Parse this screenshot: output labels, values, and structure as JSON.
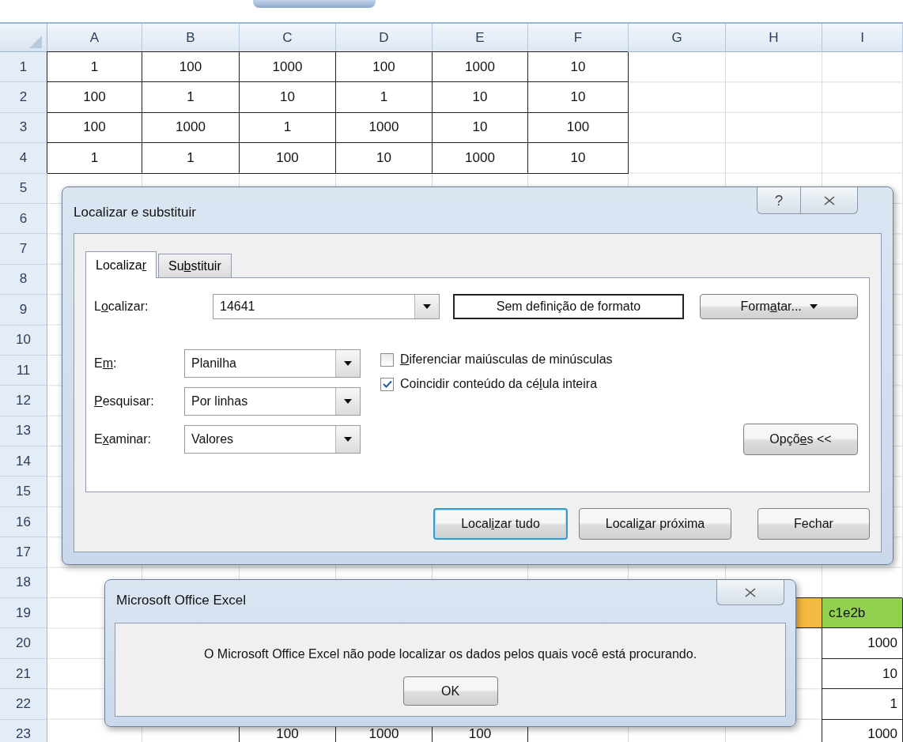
{
  "sheet": {
    "columns": [
      "A",
      "B",
      "C",
      "D",
      "E",
      "F",
      "G",
      "H",
      "I"
    ],
    "rows": [
      {
        "label": "1",
        "cells": [
          "1",
          "100",
          "1000",
          "100",
          "1000",
          "10",
          null,
          null,
          null
        ]
      },
      {
        "label": "2",
        "cells": [
          "100",
          "1",
          "10",
          "1",
          "10",
          "10",
          null,
          null,
          null
        ]
      },
      {
        "label": "3",
        "cells": [
          "100",
          "1000",
          "1",
          "1000",
          "10",
          "100",
          null,
          null,
          null
        ]
      },
      {
        "label": "4",
        "cells": [
          "1",
          "1",
          "100",
          "10",
          "1000",
          "10",
          null,
          null,
          null
        ]
      },
      {
        "label": "5",
        "cells": [
          null,
          null,
          null,
          null,
          null,
          null,
          null,
          null,
          null
        ]
      },
      {
        "label": "6",
        "cells": [
          null,
          null,
          null,
          null,
          null,
          null,
          null,
          null,
          null
        ]
      },
      {
        "label": "7",
        "cells": [
          null,
          null,
          null,
          null,
          null,
          null,
          null,
          null,
          null
        ]
      },
      {
        "label": "8",
        "cells": [
          null,
          null,
          null,
          null,
          null,
          null,
          null,
          null,
          null
        ]
      },
      {
        "label": "9",
        "cells": [
          null,
          null,
          null,
          null,
          null,
          null,
          null,
          null,
          null
        ]
      },
      {
        "label": "10",
        "cells": [
          null,
          null,
          null,
          null,
          null,
          null,
          null,
          null,
          null
        ]
      },
      {
        "label": "11",
        "cells": [
          null,
          null,
          null,
          null,
          null,
          null,
          null,
          null,
          null
        ]
      },
      {
        "label": "12",
        "cells": [
          null,
          null,
          null,
          null,
          null,
          null,
          null,
          null,
          null
        ]
      },
      {
        "label": "13",
        "cells": [
          null,
          null,
          null,
          null,
          null,
          null,
          null,
          null,
          null
        ]
      },
      {
        "label": "14",
        "cells": [
          null,
          null,
          null,
          null,
          null,
          null,
          null,
          null,
          null
        ]
      },
      {
        "label": "15",
        "cells": [
          null,
          null,
          null,
          null,
          null,
          null,
          null,
          null,
          null
        ]
      },
      {
        "label": "16",
        "cells": [
          null,
          null,
          null,
          null,
          null,
          null,
          null,
          null,
          null
        ]
      },
      {
        "label": "17",
        "cells": [
          null,
          null,
          null,
          null,
          null,
          null,
          null,
          null,
          null
        ]
      },
      {
        "label": "18",
        "cells": [
          null,
          null,
          null,
          null,
          null,
          null,
          null,
          null,
          null
        ]
      },
      {
        "label": "19",
        "cells": [
          null,
          null,
          null,
          null,
          null,
          null,
          null,
          {
            "color": "#f4b942"
          },
          {
            "text": "c1e2b",
            "color": "#92d050"
          }
        ]
      },
      {
        "label": "20",
        "cells": [
          null,
          null,
          null,
          null,
          null,
          null,
          null,
          null,
          "1000"
        ]
      },
      {
        "label": "21",
        "cells": [
          null,
          null,
          null,
          null,
          null,
          null,
          null,
          null,
          "10"
        ]
      },
      {
        "label": "22",
        "cells": [
          null,
          null,
          null,
          null,
          null,
          null,
          null,
          null,
          "1"
        ]
      },
      {
        "label": "23",
        "cells": [
          null,
          null,
          "100",
          "1000",
          "100",
          null,
          null,
          null,
          "1000"
        ]
      }
    ]
  },
  "find_dialog": {
    "title": "Localizar e substituir",
    "help_button": "?",
    "tabs": [
      {
        "pre": "Localiza",
        "key": "r",
        "selected": true
      },
      {
        "pre": "Su",
        "key": "b",
        "post": "stituir",
        "selected": false
      }
    ],
    "find_what": {
      "label": {
        "pre": "L",
        "key": "o",
        "post": "calizar:"
      },
      "value": "14641"
    },
    "format_preview": "Sem definição de formato",
    "format_button": {
      "pre": "Form",
      "key": "a",
      "post": "tar..."
    },
    "options": [
      {
        "label": {
          "pre": "E",
          "key": "m",
          "post": ":"
        },
        "value": "Planilha"
      },
      {
        "label": {
          "key": "P",
          "post": "esquisar:"
        },
        "value": "Por linhas"
      },
      {
        "label": {
          "pre": "E",
          "key": "x",
          "post": "aminar:"
        },
        "value": "Valores"
      }
    ],
    "checkboxes": [
      {
        "label": {
          "key": "D",
          "post": "iferenciar maiúsculas de minúsculas"
        },
        "checked": false
      },
      {
        "label": {
          "pre": "Coincidir conteúdo da cé",
          "key": "l",
          "post": "ula inteira"
        },
        "checked": true
      }
    ],
    "options_button": {
      "pre": "Opçõ",
      "key": "e",
      "post": "s <<"
    },
    "buttons": [
      {
        "pre": "Local",
        "key": "i",
        "post": "zar tudo",
        "default": true
      },
      {
        "pre": "Locali",
        "key": "z",
        "post": "ar próxima",
        "default": false
      },
      {
        "pre": "Fechar",
        "default": false
      }
    ]
  },
  "message_box": {
    "title": "Microsoft Office Excel",
    "message": "O Microsoft Office Excel não pode localizar os dados pelos quais você está procurando.",
    "button": "OK"
  }
}
